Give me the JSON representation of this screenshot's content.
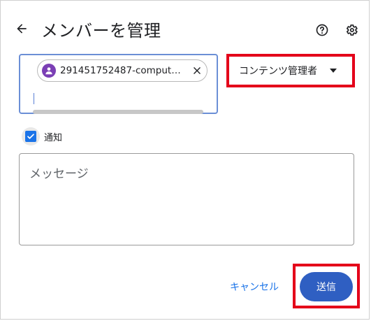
{
  "dialog": {
    "title": "メンバーを管理",
    "back_icon": "arrow-left-icon",
    "help_icon": "help-circle-icon",
    "settings_icon": "gear-icon"
  },
  "members": {
    "chip": {
      "avatar_icon": "user-avatar-icon",
      "label": "291451752487-compute…",
      "remove_icon": "close-icon"
    }
  },
  "role": {
    "selected": "コンテンツ管理者",
    "caret_icon": "caret-down-icon"
  },
  "notify": {
    "checked": true,
    "label": "通知"
  },
  "message": {
    "placeholder": "メッセージ"
  },
  "actions": {
    "cancel_label": "キャンセル",
    "send_label": "送信"
  },
  "colors": {
    "accent": "#1a73e8",
    "send_button": "#2f5fc2",
    "highlight": "#e4001a",
    "avatar": "#7b3fb5"
  }
}
